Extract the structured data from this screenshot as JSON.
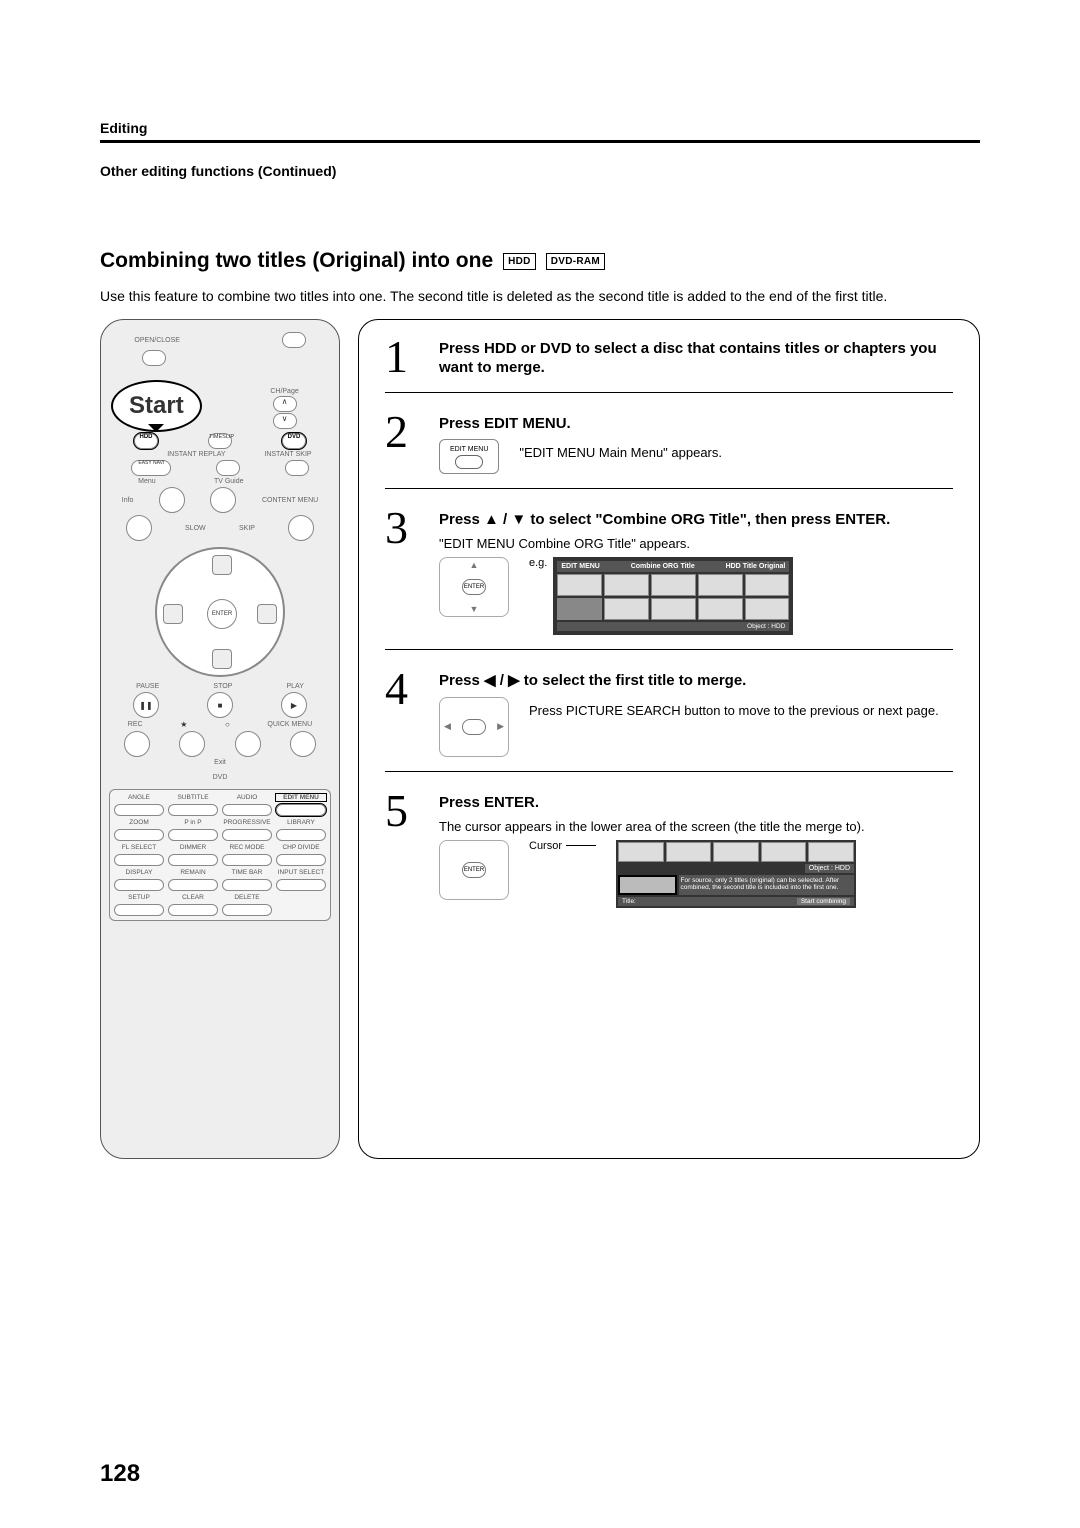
{
  "header": {
    "section": "Editing",
    "sub": "Other editing functions (Continued)"
  },
  "title": {
    "text": "Combining two titles (Original) into one",
    "badges": [
      "HDD",
      "DVD-RAM"
    ]
  },
  "intro": "Use this feature to combine two titles into one. The second title is deleted as the second title is added to the end of the first title.",
  "remote": {
    "speech": "Start",
    "openclose": "OPEN/CLOSE",
    "hdd": "HDD",
    "timeslip": "TIMESLIP",
    "dvd": "DVD",
    "instantreplay": "INSTANT REPLAY",
    "instantskip": "INSTANT SKIP",
    "easynavi": "EASY\nNAVI",
    "menu": "Menu",
    "tvguide": "TV Guide",
    "info": "Info",
    "contentmenu": "CONTENT MENU",
    "enter": "ENTER",
    "pause": "PAUSE",
    "stop": "STOP",
    "play": "PLAY",
    "rec": "REC",
    "quickmenu": "QUICK MENU",
    "exit": "Exit",
    "chpage": "CH/Page",
    "slow": "SLOW",
    "skip": "SKIP",
    "grid_labels": [
      "ANGLE",
      "SUBTITLE",
      "AUDIO",
      "EDIT MENU",
      "ZOOM",
      "P in P",
      "PROGRESSIVE",
      "LIBRARY",
      "FL SELECT",
      "DIMMER",
      "REC MODE",
      "CHP DIVIDE",
      "DISPLAY",
      "REMAIN",
      "TIME BAR",
      "INPUT SELECT",
      "SETUP",
      "CLEAR",
      "DELETE",
      ""
    ],
    "dvd_label": "DVD"
  },
  "steps": {
    "s1": {
      "num": "1",
      "head": "Press HDD or DVD to select a disc that contains titles or chapters you want to merge."
    },
    "s2": {
      "num": "2",
      "head": "Press EDIT MENU.",
      "body": "\"EDIT MENU Main Menu\" appears.",
      "btn_label": "EDIT MENU"
    },
    "s3": {
      "num": "3",
      "head": "Press ▲ / ▼ to select \"Combine ORG Title\", then press ENTER.",
      "body": "\"EDIT MENU Combine ORG Title\" appears.",
      "eg": "e.g.",
      "nav_center": "ENTER",
      "osd": {
        "menu_left": "EDIT MENU",
        "menu_title": "Combine ORG Title",
        "hdd": "HDD",
        "title": "Title",
        "original": "Original",
        "object": "Object :",
        "object_val": "HDD"
      }
    },
    "s4": {
      "num": "4",
      "head": "Press ◀ / ▶ to select the first title to merge.",
      "body": "Press PICTURE SEARCH button to move to the previous or next page."
    },
    "s5": {
      "num": "5",
      "head": "Press ENTER.",
      "body": "The cursor appears in the lower area of the screen (the title the merge to).",
      "nav_center": "ENTER",
      "cursor": "Cursor",
      "osd": {
        "object": "Object :",
        "object_val": "HDD",
        "msg": "For source, only 2 titles (original) can be selected. After combined, the second title is included into the first one.",
        "title": "Title:",
        "start": "Start combining"
      }
    }
  },
  "page_number": "128"
}
